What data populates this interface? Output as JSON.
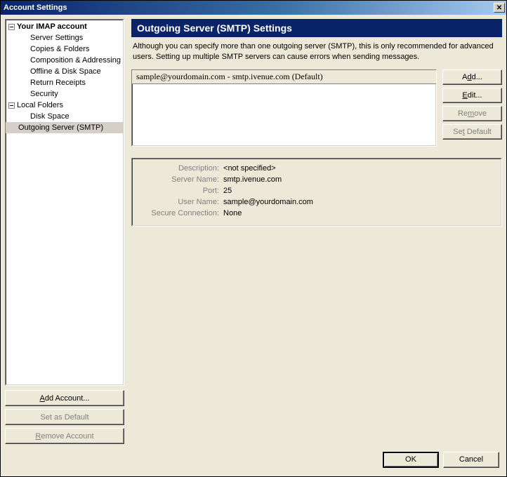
{
  "window": {
    "title": "Account Settings"
  },
  "tree": {
    "account": {
      "label": "Your IMAP account",
      "children": [
        "Server Settings",
        "Copies & Folders",
        "Composition & Addressing",
        "Offline & Disk Space",
        "Return Receipts",
        "Security"
      ]
    },
    "local": {
      "label": "Local Folders",
      "children": [
        "Disk Space"
      ]
    },
    "outgoing": {
      "label": "Outgoing Server (SMTP)"
    }
  },
  "left_buttons": {
    "add_account": "Add Account...",
    "set_default": "Set as Default",
    "remove_account": "Remove Account"
  },
  "panel": {
    "title": "Outgoing Server (SMTP) Settings",
    "desc": "Although you can specify more than one outgoing server (SMTP), this is only recommended for advanced users. Setting up multiple SMTP servers can cause errors when sending messages."
  },
  "server_list": {
    "item": "sample@yourdomain.com - smtp.ivenue.com (Default)"
  },
  "side_buttons": {
    "add": "Add...",
    "edit": "Edit...",
    "remove": "Remove",
    "set_default": "Set Default"
  },
  "details": {
    "labels": {
      "description": "Description:",
      "server_name": "Server Name:",
      "port": "Port:",
      "user_name": "User Name:",
      "secure": "Secure Connection:"
    },
    "values": {
      "description": "<not specified>",
      "server_name": "smtp.ivenue.com",
      "port": "25",
      "user_name": "sample@yourdomain.com",
      "secure": "None"
    }
  },
  "footer": {
    "ok": "OK",
    "cancel": "Cancel"
  }
}
